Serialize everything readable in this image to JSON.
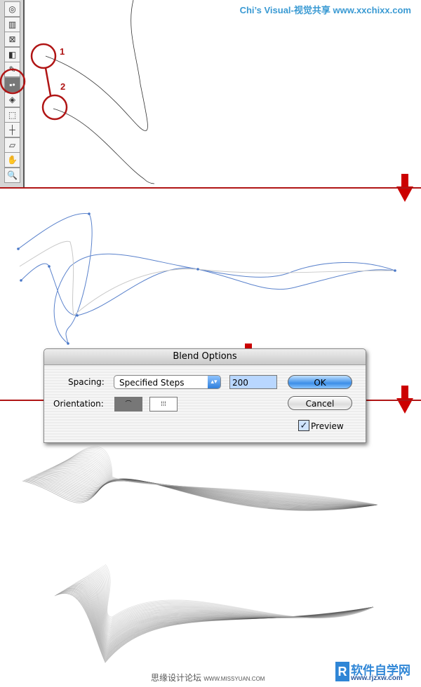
{
  "header": {
    "watermark": "Chi’s Visual-视觉共享  www.xxchixx.com"
  },
  "annotations": {
    "label1": "1",
    "label2": "2"
  },
  "toolbar": {
    "tools": [
      "symbol-sprayer",
      "graph",
      "mesh",
      "gradient",
      "eyedropper",
      "blend",
      "live-paint",
      "live-paint-selection",
      "slice",
      "eraser",
      "hand",
      "zoom"
    ]
  },
  "dialog": {
    "title": "Blend Options",
    "spacing_label": "Spacing:",
    "spacing_value": "Specified Steps",
    "steps_value": "200",
    "orientation_label": "Orientation:",
    "ok": "OK",
    "cancel": "Cancel",
    "preview_label": "Preview",
    "preview_checked": true
  },
  "footer": {
    "forum": "思缘设计论坛",
    "forum_url": "WWW.MISSYUAN.COM",
    "brand": "软件自学网",
    "brand_url": "www.rjzxw.com"
  },
  "colors": {
    "accent_red": "#b01515",
    "path_blue": "#4a78c8",
    "header_blue": "#3a9ad3"
  }
}
